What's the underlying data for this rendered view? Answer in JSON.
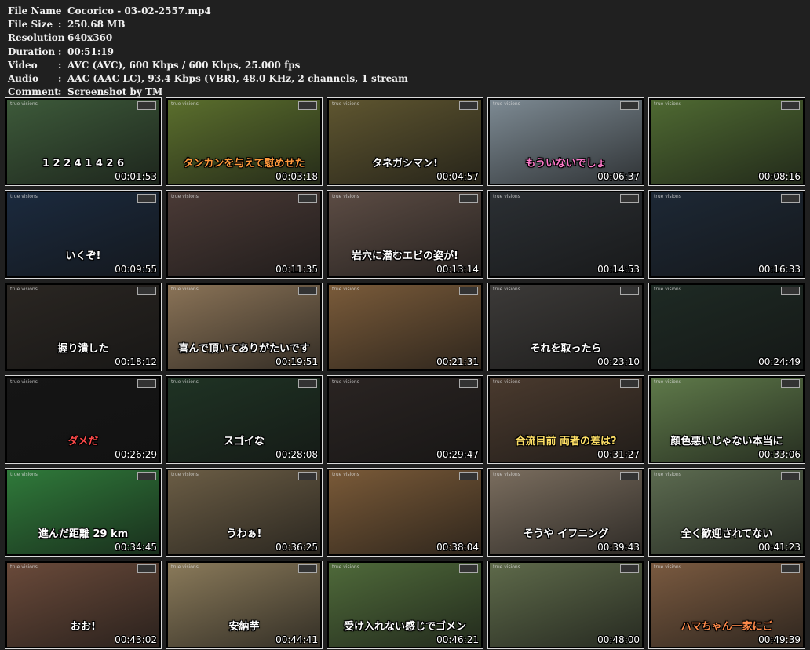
{
  "info": {
    "rows": [
      {
        "label": "File Name",
        "value": "Cocorico - 03-02-2557.mp4"
      },
      {
        "label": "File Size",
        "value": "250.68 MB"
      },
      {
        "label": "Resolution",
        "value": "640x360"
      },
      {
        "label": "Duration",
        "value": "00:51:19"
      },
      {
        "label": "Video",
        "value": "AVC (AVC), 600 Kbps / 600 Kbps, 25.000 fps"
      },
      {
        "label": "Audio",
        "value": "AAC (AAC LC), 93.4 Kbps (VBR), 48.0 KHz, 2 channels, 1 stream"
      },
      {
        "label": "Comment",
        "value": "Screenshot by TM"
      }
    ]
  },
  "channel_brand": "true visions",
  "thumbnails": [
    {
      "time": "00:01:53",
      "caption": "1 2 2 4 1 4 2 6",
      "bg": "#3d5a3a",
      "cap_color": "#ffffff"
    },
    {
      "time": "00:03:18",
      "caption": "タンカンを与えて慰めせた",
      "bg": "#5b6f2d",
      "cap_color": "#ff9a3c"
    },
    {
      "time": "00:04:57",
      "caption": "タネガシマン!",
      "bg": "#5f5630",
      "cap_color": "#ffffff"
    },
    {
      "time": "00:06:37",
      "caption": "もういないでしょ",
      "bg": "#7d8a93",
      "cap_color": "#ff7acb"
    },
    {
      "time": "00:08:16",
      "caption": "",
      "bg": "#4f6a32",
      "cap_color": "#ffffff"
    },
    {
      "time": "00:09:55",
      "caption": "いくぞ!",
      "bg": "#1b2a3e",
      "cap_color": "#ffffff"
    },
    {
      "time": "00:11:35",
      "caption": "",
      "bg": "#4a3a36",
      "cap_color": "#ffffff"
    },
    {
      "time": "00:13:14",
      "caption": "岩穴に潜むエビの姿が!",
      "bg": "#5c4c44",
      "cap_color": "#ffffff"
    },
    {
      "time": "00:14:53",
      "caption": "",
      "bg": "#2b2f33",
      "cap_color": "#ffffff"
    },
    {
      "time": "00:16:33",
      "caption": "",
      "bg": "#1d2835",
      "cap_color": "#ffffff"
    },
    {
      "time": "00:18:12",
      "caption": "握り潰した",
      "bg": "#2a2622",
      "cap_color": "#ffffff"
    },
    {
      "time": "00:19:51",
      "caption": "喜んで頂いてありがたいです",
      "bg": "#8a7357",
      "cap_color": "#ffffff"
    },
    {
      "time": "00:21:31",
      "caption": "",
      "bg": "#7a5b3a",
      "cap_color": "#ffffff"
    },
    {
      "time": "00:23:10",
      "caption": "それを取ったら",
      "bg": "#3c3a38",
      "cap_color": "#ffffff"
    },
    {
      "time": "00:24:49",
      "caption": "",
      "bg": "#1e2a24",
      "cap_color": "#ffffff"
    },
    {
      "time": "00:26:29",
      "caption": "ダメだ",
      "bg": "#151515",
      "cap_color": "#ff4a4a"
    },
    {
      "time": "00:28:08",
      "caption": "スゴイな",
      "bg": "#1f3324",
      "cap_color": "#ffffff"
    },
    {
      "time": "00:29:47",
      "caption": "",
      "bg": "#2a2422",
      "cap_color": "#ffffff"
    },
    {
      "time": "00:31:27",
      "caption": "合流目前 両者の差は?",
      "bg": "#4a3a2e",
      "cap_color": "#ffe066"
    },
    {
      "time": "00:33:06",
      "caption": "顔色悪いじゃない本当に",
      "bg": "#5f7a4a",
      "cap_color": "#ffffff"
    },
    {
      "time": "00:34:45",
      "caption": "進んだ距離 29 km",
      "bg": "#2f7a3a",
      "cap_color": "#ffffff"
    },
    {
      "time": "00:36:25",
      "caption": "うわぁ!",
      "bg": "#6b5d45",
      "cap_color": "#ffffff"
    },
    {
      "time": "00:38:04",
      "caption": "",
      "bg": "#7a5a38",
      "cap_color": "#ffffff"
    },
    {
      "time": "00:39:43",
      "caption": "そうや イフニング",
      "bg": "#7a6d5e",
      "cap_color": "#ffffff"
    },
    {
      "time": "00:41:23",
      "caption": "全く歓迎されてない",
      "bg": "#5c6b50",
      "cap_color": "#ffffff"
    },
    {
      "time": "00:43:02",
      "caption": "おお!",
      "bg": "#6a4a3a",
      "cap_color": "#ffffff"
    },
    {
      "time": "00:44:41",
      "caption": "安納芋",
      "bg": "#8a7a5a",
      "cap_color": "#ffffff"
    },
    {
      "time": "00:46:21",
      "caption": "受け入れない感じでゴメン",
      "bg": "#4f6a3a",
      "cap_color": "#ffffff"
    },
    {
      "time": "00:48:00",
      "caption": "",
      "bg": "#5e6a4a",
      "cap_color": "#ffffff"
    },
    {
      "time": "00:49:39",
      "caption": "ハマちゃん一家にご",
      "bg": "#7a5a40",
      "cap_color": "#ff8a4a"
    }
  ]
}
